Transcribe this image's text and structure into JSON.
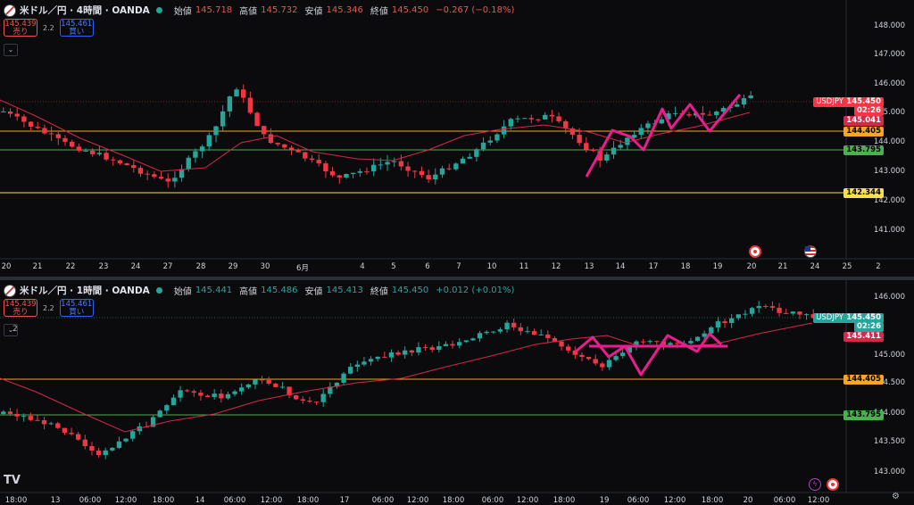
{
  "colors": {
    "up": "#26a69a",
    "down": "#f23645",
    "ma": "#d5284a",
    "pattern": "#e91e8c",
    "orange": "#f5a623",
    "green": "#4caf50",
    "yellow": "#f7e14b"
  },
  "top": {
    "symbol": "米ドル／円 · 4時間 · OANDA",
    "open_label": "始値",
    "open": "145.718",
    "high_label": "高値",
    "high": "145.732",
    "low_label": "安値",
    "low": "145.346",
    "close_label": "終値",
    "close": "145.450",
    "change": "−0.267 (−0.18%)",
    "sell_price": "145.439",
    "sell_label": "売り",
    "spread": "2.2",
    "buy_price": "145.461",
    "buy_label": "買い",
    "collapse_icon": "chevron-down-icon",
    "price_axis": [
      "148.000",
      "147.000",
      "146.000",
      "145.000",
      "144.000",
      "143.000",
      "142.000",
      "141.000"
    ],
    "ticker": "USDJPY",
    "last_price": "145.450",
    "countdown": "02:26",
    "ma_value": "145.041",
    "orange_level": "144.405",
    "green_level": "143.795",
    "yellow_level": "142.344",
    "time_axis": [
      "20",
      "21",
      "22",
      "23",
      "24",
      "27",
      "28",
      "29",
      "30",
      "6月",
      "4",
      "5",
      "6",
      "7",
      "10",
      "11",
      "12",
      "13",
      "14",
      "17",
      "18",
      "19",
      "20",
      "21",
      "24",
      "25",
      "2"
    ]
  },
  "bottom": {
    "symbol": "米ドル／円 · 1時間 · OANDA",
    "open_label": "始値",
    "open": "145.441",
    "high_label": "高値",
    "high": "145.486",
    "low_label": "安値",
    "low": "145.413",
    "close_label": "終値",
    "close": "145.450",
    "change": "+0.012 (+0.01%)",
    "sell_price": "145.439",
    "sell_label": "売り",
    "spread": "2.2",
    "buy_price": "145.461",
    "buy_label": "買い",
    "pane_index": "2",
    "price_axis": [
      "146.000",
      "145.000",
      "144.500",
      "144.000",
      "143.500",
      "143.000"
    ],
    "ticker": "USDJPY",
    "last_price": "145.450",
    "countdown": "02:26",
    "ma_value": "145.411",
    "orange_level": "144.405",
    "green_level": "143.795",
    "time_axis": [
      "18:00",
      "13",
      "06:00",
      "12:00",
      "18:00",
      "14",
      "06:00",
      "12:00",
      "18:00",
      "17",
      "06:00",
      "12:00",
      "18:00",
      "06:00",
      "12:00",
      "18:00",
      "19",
      "06:00",
      "12:00",
      "18:00",
      "20",
      "06:00",
      "12:00"
    ]
  },
  "logo": "TV"
}
